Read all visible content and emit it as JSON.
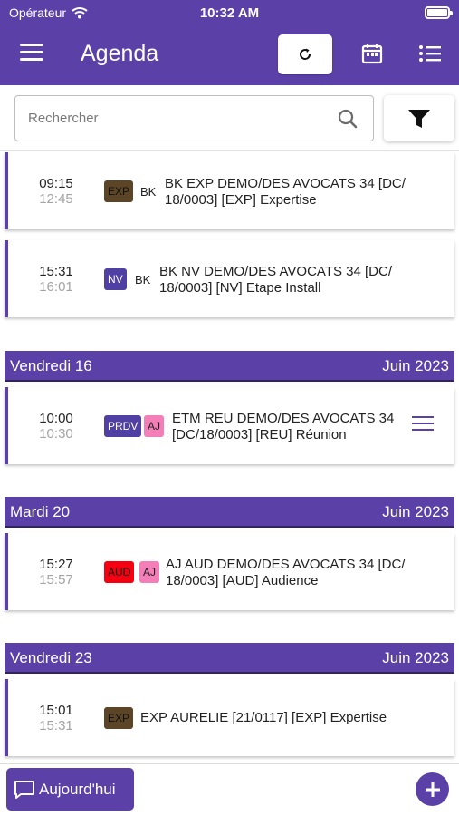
{
  "status_bar": {
    "carrier": "Opérateur",
    "time": "10:32 AM"
  },
  "app": {
    "title": "Agenda"
  },
  "search": {
    "placeholder": "Rechercher"
  },
  "colors": {
    "primary": "#5b40a8",
    "exp": "#5c4426",
    "nv": "#5040a3",
    "aj": "#f47eb8",
    "aud": "#f60011"
  },
  "events": [
    {
      "start": "09:15",
      "end": "12:45",
      "badges": [
        "EXP"
      ],
      "who": "BK",
      "line1": "BK EXP DEMO/DES AVOCATS 34 [DC/",
      "line2": "18/0003] [EXP] Expertise"
    },
    {
      "start": "15:31",
      "end": "16:01",
      "badges": [
        "NV"
      ],
      "who": "BK",
      "line1": "BK NV DEMO/DES AVOCATS 34 [DC/",
      "line2": "18/0003] [NV] Etape Install"
    },
    {
      "start": "10:00",
      "end": "10:30",
      "badges": [
        "PRDV",
        "AJ"
      ],
      "who": "",
      "line1": "ETM REU DEMO/DES AVOCATS 34",
      "line2": "[DC/18/0003] [REU] Réunion"
    },
    {
      "start": "15:27",
      "end": "15:57",
      "badges": [
        "AUD",
        "AJ"
      ],
      "who": "",
      "line1": "AJ AUD DEMO/DES AVOCATS 34 [DC/",
      "line2": "18/0003] [AUD] Audience"
    },
    {
      "start": "15:01",
      "end": "15:31",
      "badges": [
        "EXP"
      ],
      "who": "",
      "line1": "EXP AURELIE [21/0117] [EXP] Expertise",
      "line2": ""
    }
  ],
  "day_headers": [
    {
      "day": "Vendredi 16",
      "month": "Juin 2023"
    },
    {
      "day": "Mardi 20",
      "month": "Juin 2023"
    },
    {
      "day": "Vendredi 23",
      "month": "Juin 2023"
    }
  ],
  "bottom": {
    "today_label": "Aujourd'hui"
  }
}
